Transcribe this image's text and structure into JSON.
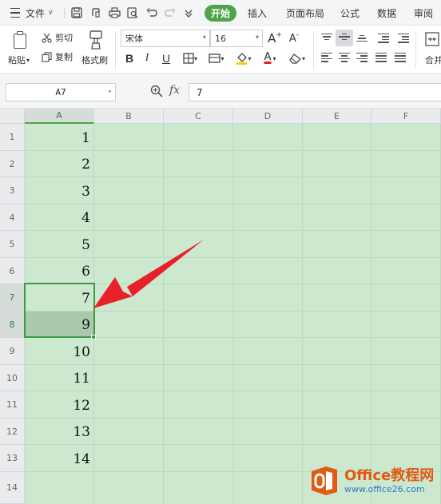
{
  "menubar": {
    "file_label": "文件",
    "tabs": [
      "开始",
      "插入",
      "页面布局",
      "公式",
      "数据",
      "审阅"
    ]
  },
  "ribbon": {
    "paste_label": "粘贴",
    "cut_label": "剪切",
    "copy_label": "复制",
    "format_painter_label": "格式刷",
    "font_name": "宋体",
    "font_size": "16",
    "merge_label": "合并",
    "bold_label": "B",
    "italic_label": "I",
    "underline_label": "U",
    "font_color_label": "A",
    "grow_label": "A",
    "shrink_label": "A"
  },
  "formula_bar": {
    "name_box": "A7",
    "fx_label": "fx",
    "content": "7"
  },
  "grid": {
    "columns": [
      "A",
      "B",
      "C",
      "D",
      "E",
      "F"
    ],
    "rows": [
      "1",
      "2",
      "3",
      "4",
      "5",
      "6",
      "7",
      "8",
      "9",
      "10",
      "11",
      "12",
      "13",
      "14"
    ],
    "column_a_values": [
      "1",
      "2",
      "3",
      "4",
      "5",
      "6",
      "7",
      "9",
      "10",
      "11",
      "12",
      "13",
      "14"
    ],
    "selected_range": "A7:A8"
  },
  "watermark": {
    "title": "Office教程网",
    "url": "www.office26.com"
  },
  "colors": {
    "accent_green": "#4ea44a",
    "sheet_background": "#cce8cf",
    "selection_border": "#3d9a43",
    "arrow_red": "#e8202a",
    "watermark_orange": "#e05a12"
  },
  "icons": [
    "hamburger-menu-icon",
    "save-icon",
    "cloud-sync-icon",
    "print-icon",
    "print-preview-icon",
    "undo-icon",
    "redo-icon",
    "more-icon",
    "paste-icon",
    "scissors-icon",
    "copy-icon",
    "format-painter-icon",
    "borders-icon",
    "fill-color-icon",
    "eraser-icon",
    "zoom-icon",
    "red-arrow-annotation"
  ]
}
